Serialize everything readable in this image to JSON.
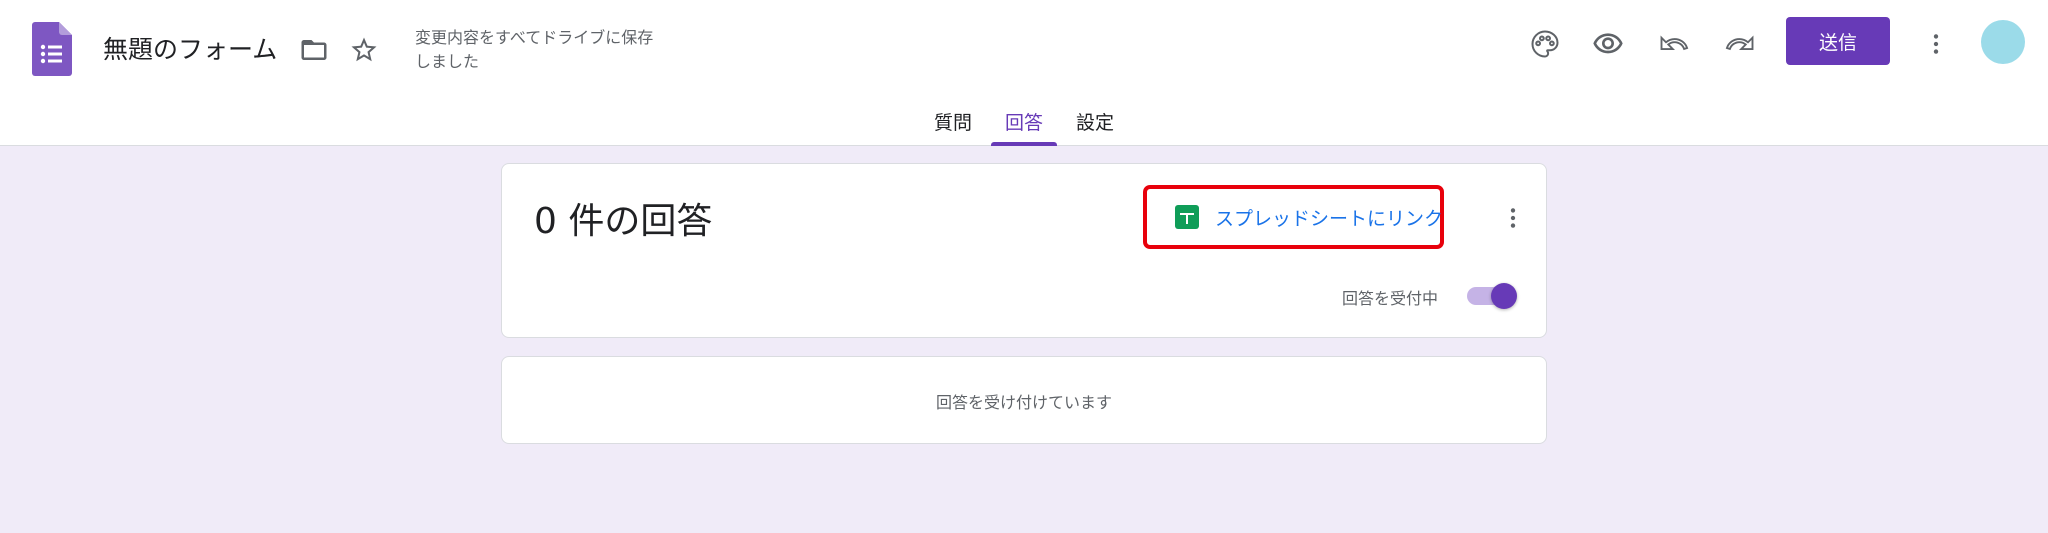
{
  "header": {
    "form_title": "無題のフォーム",
    "save_status": "変更内容をすべてドライブに保存しました",
    "send_label": "送信"
  },
  "tabs": [
    {
      "label": "質問"
    },
    {
      "label": "回答",
      "active": true
    },
    {
      "label": "設定"
    }
  ],
  "summary": {
    "response_count": "0 件の回答",
    "link_sheet_label": "スプレッドシートにリンク",
    "accepting_label": "回答を受付中",
    "accepting_responses": true
  },
  "empty_state": {
    "message": "回答を受け付けています"
  },
  "colors": {
    "accent": "#673ab7",
    "link": "#1a73e8",
    "highlight": "#e8000b",
    "sheets_green": "#0f9d58",
    "background": "#f0ebf8"
  },
  "icons": [
    "forms-logo-icon",
    "folder-icon",
    "star-icon",
    "palette-icon",
    "eye-icon",
    "undo-icon",
    "redo-icon",
    "more-vert-icon",
    "sheets-icon"
  ]
}
